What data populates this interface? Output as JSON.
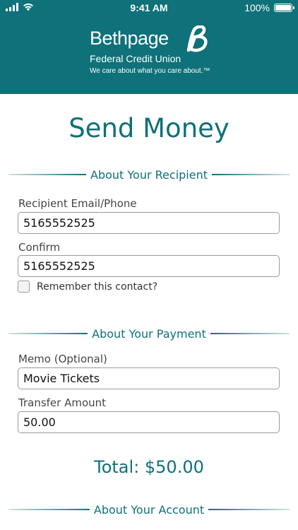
{
  "status_bar": {
    "time": "9:41 AM",
    "battery": "100%",
    "signal_icon": "cellular-signal-icon",
    "wifi_icon": "wifi-icon",
    "battery_icon": "battery-icon"
  },
  "brand": {
    "name": "Bethpage",
    "subtitle": "Federal Credit Union",
    "tagline": "We care about what you care about.™",
    "logo_icon": "bethpage-b-logo-icon",
    "header_color": "#0f7179"
  },
  "page": {
    "title": "Send Money"
  },
  "recipient": {
    "section_title": "About Your Recipient",
    "email_label": "Recipient Email/Phone",
    "email_value": "5165552525",
    "confirm_label": "Confirm",
    "confirm_value": "5165552525",
    "remember_label": "Remember this contact?",
    "remember_checked": false
  },
  "payment": {
    "section_title": "About Your Payment",
    "memo_label": "Memo (Optional)",
    "memo_value": "Movie Tickets",
    "amount_label": "Transfer Amount",
    "amount_value": "50.00",
    "total": "Total: $50.00"
  },
  "account": {
    "section_title": "About Your Account"
  }
}
